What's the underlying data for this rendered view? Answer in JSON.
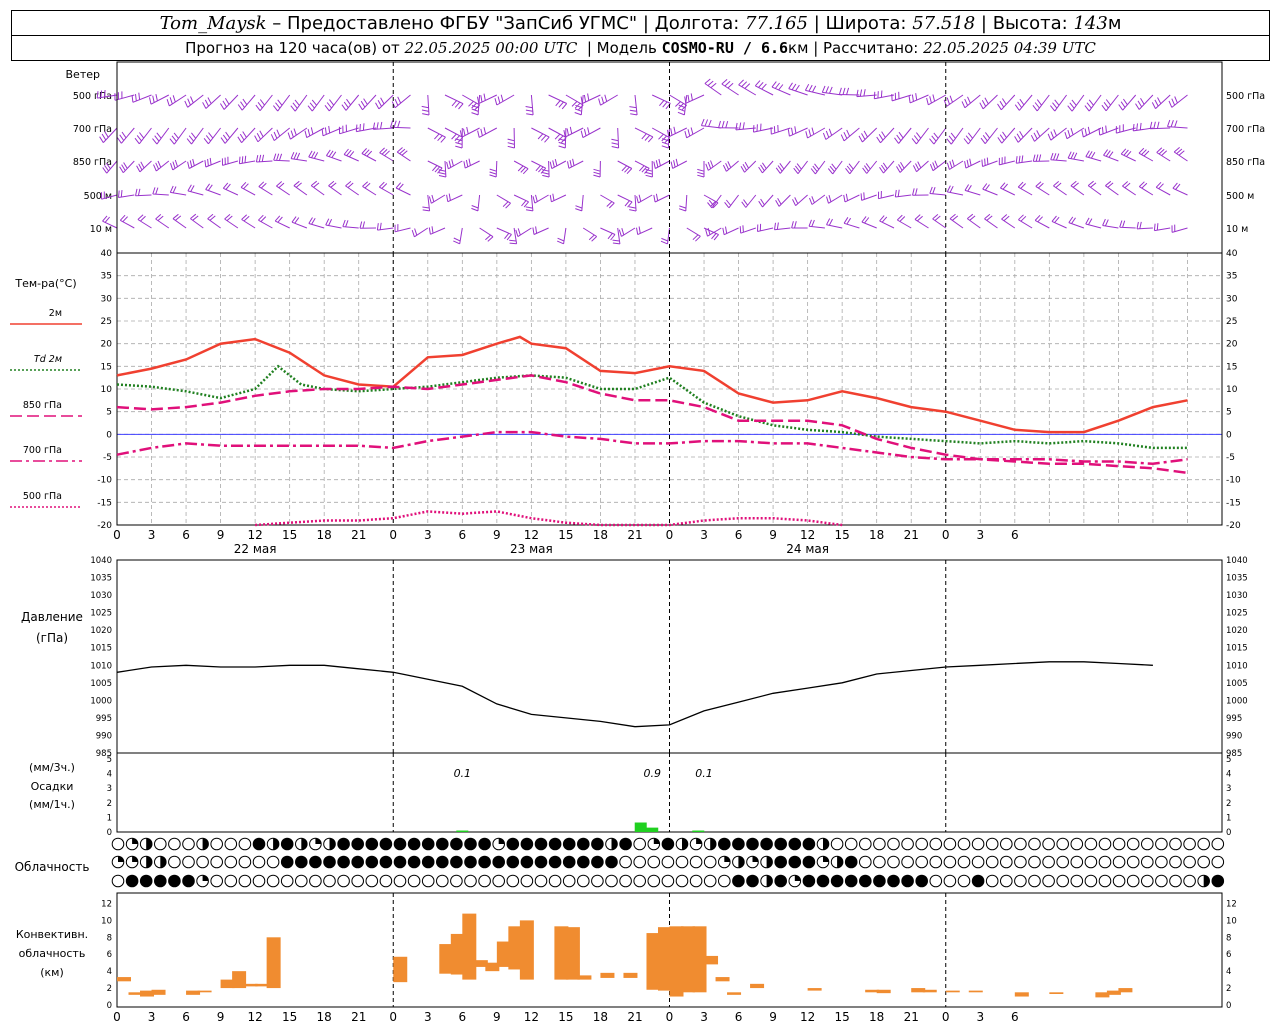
{
  "header": {
    "station": "Tom_Maysk",
    "provider": " – Предоставлено ФГБУ \"ЗапСиб УГМС\" | ",
    "lon_label": "Долгота: ",
    "lon": "77.165",
    "lat_label": " | Широта: ",
    "lat": "57.518",
    "alt_label": " | Высота: ",
    "alt": "143",
    "alt_unit": "м",
    "forecast_prefix": "Прогноз на 120 часа(ов) от ",
    "forecast_time": "22.05.2025 00:00 UTC",
    "model_label": "  | Модель ",
    "model": "COSMO-RU / 6.6",
    "model_unit": "км | Рассчитано: ",
    "calc_time": "22.05.2025 04:39 UTC"
  },
  "time_axis": {
    "hour_ticks": [
      "0",
      "3",
      "6",
      "9",
      "12",
      "15",
      "18",
      "21",
      "0",
      "3",
      "6",
      "9",
      "12",
      "15",
      "18",
      "21",
      "0",
      "3",
      "6",
      "9",
      "12",
      "15",
      "18",
      "21",
      "0",
      "3",
      "6"
    ],
    "day_labels": [
      "22 мая",
      "23 мая",
      "24 мая"
    ]
  },
  "wind_panel": {
    "title": "Ветер",
    "levels": [
      "500 гПа",
      "700 гПа",
      "850 гПа",
      "500 м",
      "10 м"
    ],
    "color": "#9932CC"
  },
  "chart_data": [
    {
      "type": "line",
      "title": "Тем-ра(°C)",
      "x_unit": "hours from 22.05.2025 00 UTC",
      "ylim": [
        -20,
        40
      ],
      "yticks": [
        40,
        35,
        30,
        25,
        20,
        15,
        10,
        5,
        0,
        -5,
        -10,
        -15,
        -20
      ],
      "legend": [
        {
          "name": "2м",
          "color": "#F04030",
          "style": "solid"
        },
        {
          "name": "Td 2м",
          "color": "#208020",
          "style": "dotted"
        },
        {
          "name": "850 гПа",
          "color": "#E0107A",
          "style": "dashed"
        },
        {
          "name": "700 гПа",
          "color": "#E0107A",
          "style": "dashdot"
        },
        {
          "name": "500 гПа",
          "color": "#E0107A",
          "style": "dotted"
        }
      ],
      "series": [
        {
          "name": "2м",
          "points": [
            [
              0,
              13
            ],
            [
              3,
              14.5
            ],
            [
              6,
              16.5
            ],
            [
              9,
              20
            ],
            [
              12,
              21
            ],
            [
              15,
              18
            ],
            [
              18,
              13
            ],
            [
              21,
              11
            ],
            [
              24,
              10.5
            ],
            [
              27,
              17
            ],
            [
              30,
              17.5
            ],
            [
              33,
              20
            ],
            [
              35,
              21.5
            ],
            [
              36,
              20
            ],
            [
              39,
              19
            ],
            [
              42,
              14
            ],
            [
              45,
              13.5
            ],
            [
              48,
              15
            ],
            [
              51,
              14
            ],
            [
              54,
              9
            ],
            [
              57,
              7
            ],
            [
              60,
              7.5
            ],
            [
              63,
              9.5
            ],
            [
              66,
              8
            ],
            [
              69,
              6
            ],
            [
              72,
              5
            ],
            [
              75,
              3
            ],
            [
              78,
              1
            ],
            [
              81,
              0.5
            ],
            [
              84,
              0.5
            ],
            [
              87,
              3
            ],
            [
              90,
              6
            ],
            [
              93,
              7.5
            ]
          ]
        },
        {
          "name": "Td 2м",
          "points": [
            [
              0,
              11
            ],
            [
              3,
              10.5
            ],
            [
              6,
              9.5
            ],
            [
              9,
              8
            ],
            [
              12,
              10
            ],
            [
              14,
              15
            ],
            [
              16,
              11
            ],
            [
              18,
              10
            ],
            [
              21,
              9.5
            ],
            [
              24,
              10
            ],
            [
              27,
              10.5
            ],
            [
              30,
              11.5
            ],
            [
              33,
              12.5
            ],
            [
              36,
              13
            ],
            [
              39,
              12.5
            ],
            [
              42,
              10
            ],
            [
              45,
              10
            ],
            [
              48,
              12.5
            ],
            [
              51,
              7
            ],
            [
              54,
              4
            ],
            [
              57,
              2
            ],
            [
              60,
              1
            ],
            [
              63,
              0.5
            ],
            [
              66,
              -0.5
            ],
            [
              69,
              -1
            ],
            [
              72,
              -1.5
            ],
            [
              75,
              -2
            ],
            [
              78,
              -1.5
            ],
            [
              81,
              -2
            ],
            [
              84,
              -1.5
            ],
            [
              87,
              -2
            ],
            [
              90,
              -3
            ],
            [
              93,
              -3
            ]
          ]
        },
        {
          "name": "850 гПа",
          "points": [
            [
              0,
              6
            ],
            [
              3,
              5.5
            ],
            [
              6,
              6
            ],
            [
              9,
              7
            ],
            [
              12,
              8.5
            ],
            [
              15,
              9.5
            ],
            [
              18,
              10
            ],
            [
              21,
              10
            ],
            [
              24,
              10.5
            ],
            [
              27,
              10
            ],
            [
              30,
              11
            ],
            [
              33,
              12
            ],
            [
              36,
              13
            ],
            [
              39,
              11.5
            ],
            [
              42,
              9
            ],
            [
              45,
              7.5
            ],
            [
              48,
              7.5
            ],
            [
              51,
              6
            ],
            [
              54,
              3
            ],
            [
              57,
              3
            ],
            [
              60,
              3
            ],
            [
              63,
              2
            ],
            [
              66,
              -1
            ],
            [
              69,
              -3
            ],
            [
              72,
              -4.5
            ],
            [
              75,
              -5.5
            ],
            [
              78,
              -6
            ],
            [
              81,
              -6.5
            ],
            [
              84,
              -6.5
            ],
            [
              87,
              -7
            ],
            [
              90,
              -7.5
            ],
            [
              93,
              -8.5
            ]
          ]
        },
        {
          "name": "700 гПа",
          "points": [
            [
              0,
              -4.5
            ],
            [
              3,
              -3
            ],
            [
              6,
              -2
            ],
            [
              9,
              -2.5
            ],
            [
              12,
              -2.5
            ],
            [
              15,
              -2.5
            ],
            [
              18,
              -2.5
            ],
            [
              21,
              -2.5
            ],
            [
              24,
              -3
            ],
            [
              27,
              -1.5
            ],
            [
              30,
              -0.5
            ],
            [
              33,
              0.5
            ],
            [
              36,
              0.5
            ],
            [
              39,
              -0.5
            ],
            [
              42,
              -1
            ],
            [
              45,
              -2
            ],
            [
              48,
              -2
            ],
            [
              51,
              -1.5
            ],
            [
              54,
              -1.5
            ],
            [
              57,
              -2
            ],
            [
              60,
              -2
            ],
            [
              63,
              -3
            ],
            [
              66,
              -4
            ],
            [
              69,
              -5
            ],
            [
              72,
              -5.5
            ],
            [
              75,
              -5.5
            ],
            [
              78,
              -5.5
            ],
            [
              81,
              -5.5
            ],
            [
              84,
              -6
            ],
            [
              87,
              -6
            ],
            [
              90,
              -6.5
            ],
            [
              93,
              -5.5
            ]
          ]
        },
        {
          "name": "500 гПа",
          "points": [
            [
              12,
              -20
            ],
            [
              15,
              -19.5
            ],
            [
              18,
              -19
            ],
            [
              21,
              -19
            ],
            [
              24,
              -18.5
            ],
            [
              27,
              -17
            ],
            [
              30,
              -17.5
            ],
            [
              33,
              -17
            ],
            [
              36,
              -18.5
            ],
            [
              39,
              -19.5
            ],
            [
              42,
              -20
            ],
            [
              45,
              -20
            ],
            [
              48,
              -20
            ],
            [
              51,
              -19
            ],
            [
              54,
              -18.5
            ],
            [
              57,
              -18.5
            ],
            [
              60,
              -19
            ],
            [
              63,
              -20
            ]
          ]
        }
      ]
    },
    {
      "type": "line",
      "title": "Давление (гПа)",
      "ylim": [
        985,
        1040
      ],
      "yticks": [
        1040,
        1035,
        1030,
        1025,
        1020,
        1015,
        1010,
        1005,
        1000,
        995,
        990,
        985
      ],
      "series": [
        {
          "name": "Давление",
          "color": "#000000",
          "points": [
            [
              0,
              1008
            ],
            [
              3,
              1009.5
            ],
            [
              6,
              1010
            ],
            [
              9,
              1009.5
            ],
            [
              12,
              1009.5
            ],
            [
              15,
              1010
            ],
            [
              18,
              1010
            ],
            [
              21,
              1009
            ],
            [
              24,
              1008
            ],
            [
              27,
              1006
            ],
            [
              30,
              1004
            ],
            [
              33,
              999
            ],
            [
              36,
              996
            ],
            [
              39,
              995
            ],
            [
              42,
              994
            ],
            [
              45,
              992.5
            ],
            [
              48,
              993
            ],
            [
              51,
              997
            ],
            [
              54,
              999.5
            ],
            [
              57,
              1002
            ],
            [
              60,
              1003.5
            ],
            [
              63,
              1005
            ],
            [
              66,
              1007.5
            ],
            [
              69,
              1008.5
            ],
            [
              72,
              1009.5
            ],
            [
              75,
              1010
            ],
            [
              78,
              1010.5
            ],
            [
              81,
              1011
            ],
            [
              84,
              1011
            ],
            [
              87,
              1010.5
            ],
            [
              90,
              1010
            ]
          ]
        }
      ]
    },
    {
      "type": "bar",
      "title": "Осадки (мм/3ч.) (мм/1ч.)",
      "ylim": [
        0,
        5
      ],
      "yticks": [
        5,
        4,
        3,
        2,
        1,
        0
      ],
      "annotations": [
        {
          "x": 30,
          "text": "0.1"
        },
        {
          "x": 46.5,
          "text": "0.9"
        },
        {
          "x": 51,
          "text": "0.1"
        }
      ],
      "bars": [
        {
          "x": 30,
          "value": 0.1,
          "color": "#20D020"
        },
        {
          "x": 45.5,
          "value": 0.65,
          "color": "#20D020"
        },
        {
          "x": 46.5,
          "value": 0.3,
          "color": "#20D020"
        },
        {
          "x": 50.5,
          "value": 0.1,
          "color": "#20D020"
        }
      ]
    },
    {
      "type": "bar",
      "title": "Конвективн. облачность (км)",
      "ylim": [
        0,
        13
      ],
      "yticks": [
        12,
        10,
        8,
        6,
        4,
        2,
        0
      ],
      "color": "#F08C30",
      "bars": [
        [
          0,
          2.8,
          3.3
        ],
        [
          1,
          1.2,
          1.5
        ],
        [
          2,
          1,
          1.7
        ],
        [
          3,
          1.2,
          1.8
        ],
        [
          6,
          1.2,
          1.7
        ],
        [
          7,
          1.5,
          1.7
        ],
        [
          9,
          2,
          3
        ],
        [
          10,
          2,
          4
        ],
        [
          11,
          2.2,
          2.5
        ],
        [
          12,
          2.2,
          2.5
        ],
        [
          13,
          2,
          8
        ],
        [
          24,
          2.7,
          5.7
        ],
        [
          28,
          3.7,
          7.2
        ],
        [
          29,
          3.6,
          8.4
        ],
        [
          30,
          3,
          10.8
        ],
        [
          31,
          4.5,
          5.3
        ],
        [
          32,
          4,
          5
        ],
        [
          33,
          4.5,
          7.5
        ],
        [
          34,
          4.2,
          9.3
        ],
        [
          35,
          3,
          10
        ],
        [
          38,
          3,
          9.3
        ],
        [
          39,
          3,
          9.2
        ],
        [
          40,
          3,
          3.5
        ],
        [
          42,
          3.2,
          3.8
        ],
        [
          44,
          3.2,
          3.8
        ],
        [
          46,
          1.8,
          2.2
        ],
        [
          46,
          2,
          8.5
        ],
        [
          47,
          1.7,
          9.2
        ],
        [
          48,
          1,
          9.3
        ],
        [
          49,
          1.5,
          9.3
        ],
        [
          50,
          1.5,
          9.3
        ],
        [
          51,
          4.8,
          5.8
        ],
        [
          52,
          2.8,
          3.3
        ],
        [
          53,
          1.2,
          1.5
        ],
        [
          55,
          2,
          2.5
        ],
        [
          60,
          1.7,
          2
        ],
        [
          65,
          1.5,
          1.8
        ],
        [
          66,
          1.4,
          1.8
        ],
        [
          69,
          1.5,
          2
        ],
        [
          70,
          1.5,
          1.8
        ],
        [
          72,
          1.5,
          1.7
        ],
        [
          74,
          1.5,
          1.7
        ],
        [
          78,
          1,
          1.5
        ],
        [
          81,
          1.3,
          1.5
        ],
        [
          85,
          0.9,
          1.5
        ],
        [
          86,
          1.2,
          1.7
        ],
        [
          87,
          1.5,
          2
        ]
      ]
    }
  ],
  "cloud_panel": {
    "title": "Облачность",
    "rows": [
      "eqheeeheeefhfhqhfffffffffffqfffffffhfeqfhqhfffffffheeeeeeeeeeeeeeeeeeeeeeeeeeeeee",
      "qqhheeeeeeeeffffffffffffffffffffffffeeeeeeeqhqhfffqhfeeeeeeeeeeeeeeeeeeeeeeeeeeee",
      "efffffqeeeeeeeeeeeeeeeeeeeeeeeeeeeeeeeeeeeeeffhfqfffffffffeeefeeeeeeeeeeeeeeehfffff"
    ]
  },
  "panel_labels": {
    "temp": "Тем-ра(°C)",
    "pressure": "Давление",
    "pressure_unit": "(гПа)",
    "precip1": "(мм/3ч.)",
    "precip2": "Осадки",
    "precip3": "(мм/1ч.)",
    "cloud": "Облачность",
    "conv1": "Конвективн.",
    "conv2": "облачность",
    "conv3": "(км)"
  }
}
